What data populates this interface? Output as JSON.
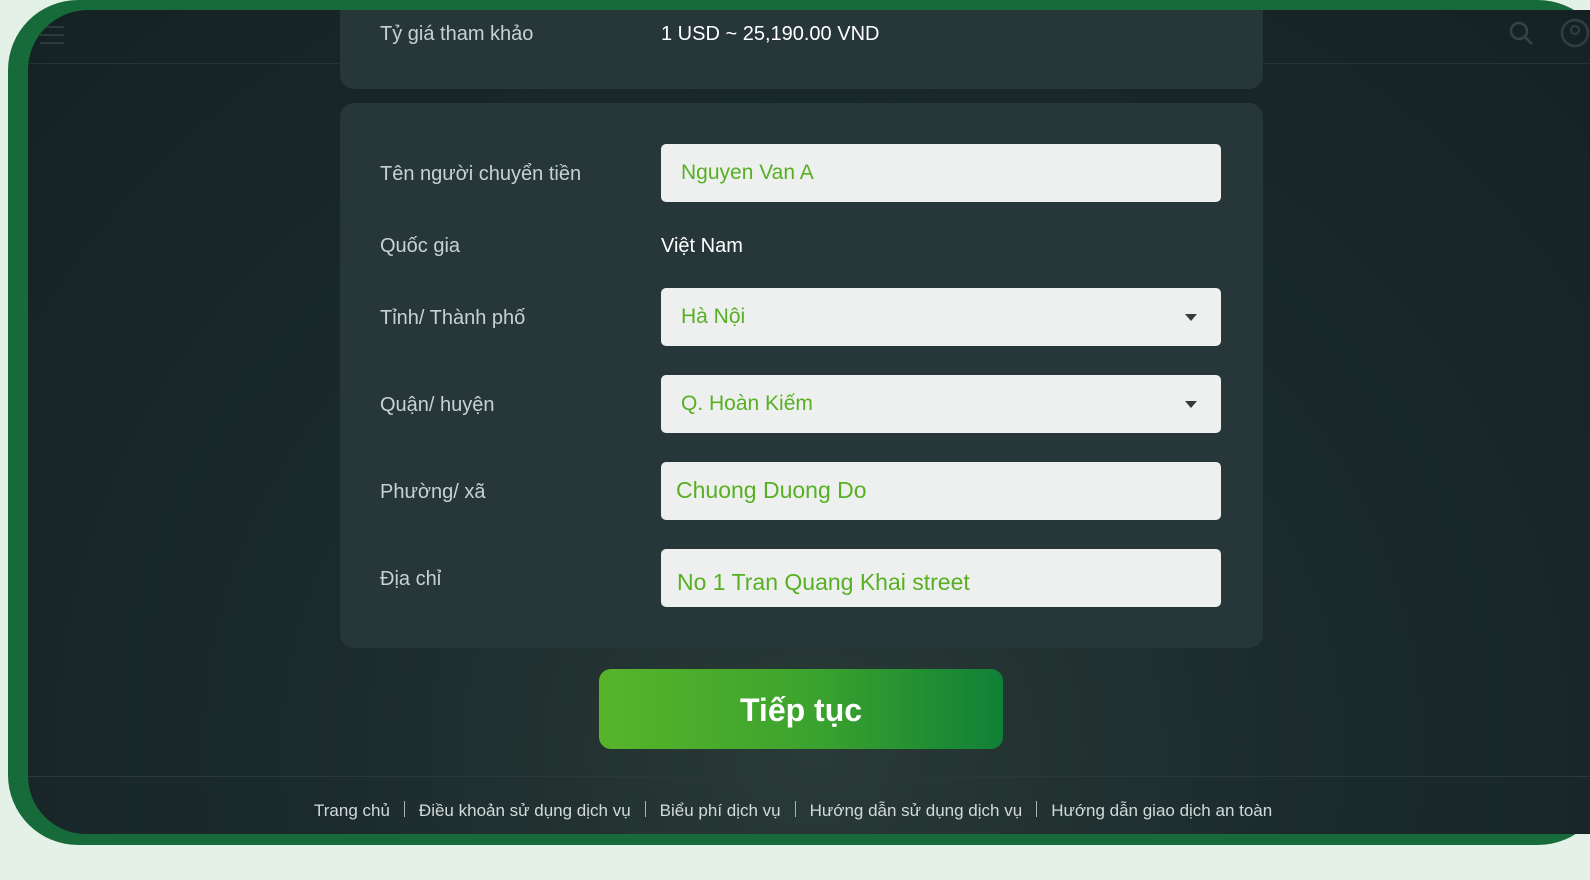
{
  "rate": {
    "label": "Tỷ giá tham khảo",
    "value": "1 USD ~ 25,190.00 VND"
  },
  "form": {
    "sender_name": {
      "label": "Tên người chuyển tiền",
      "value": "Nguyen Van A"
    },
    "country": {
      "label": "Quốc gia",
      "value": "Việt Nam"
    },
    "province": {
      "label": "Tỉnh/ Thành phố",
      "value": "Hà Nội"
    },
    "district": {
      "label": "Quận/ huyện",
      "value": "Q. Hoàn Kiếm"
    },
    "ward": {
      "label": "Phường/ xã",
      "value": "Chuong Duong Do"
    },
    "address": {
      "label": "Địa chỉ",
      "value": "No 1 Tran Quang Khai street"
    }
  },
  "actions": {
    "continue_label": "Tiếp tục"
  },
  "footer": {
    "links": [
      "Trang chủ",
      "Điều khoản sử dụng dịch vụ",
      "Biểu phí dịch vụ",
      "Hướng dẫn sử dụng dịch vụ",
      "Hướng dẫn giao dịch an toàn"
    ]
  },
  "colors": {
    "accent_green": "#57b022",
    "frame_green": "#176b3a",
    "panel_bg": "#263639"
  },
  "icons": [
    "menu-icon",
    "search-icon",
    "user-icon",
    "chevron-down-icon"
  ]
}
